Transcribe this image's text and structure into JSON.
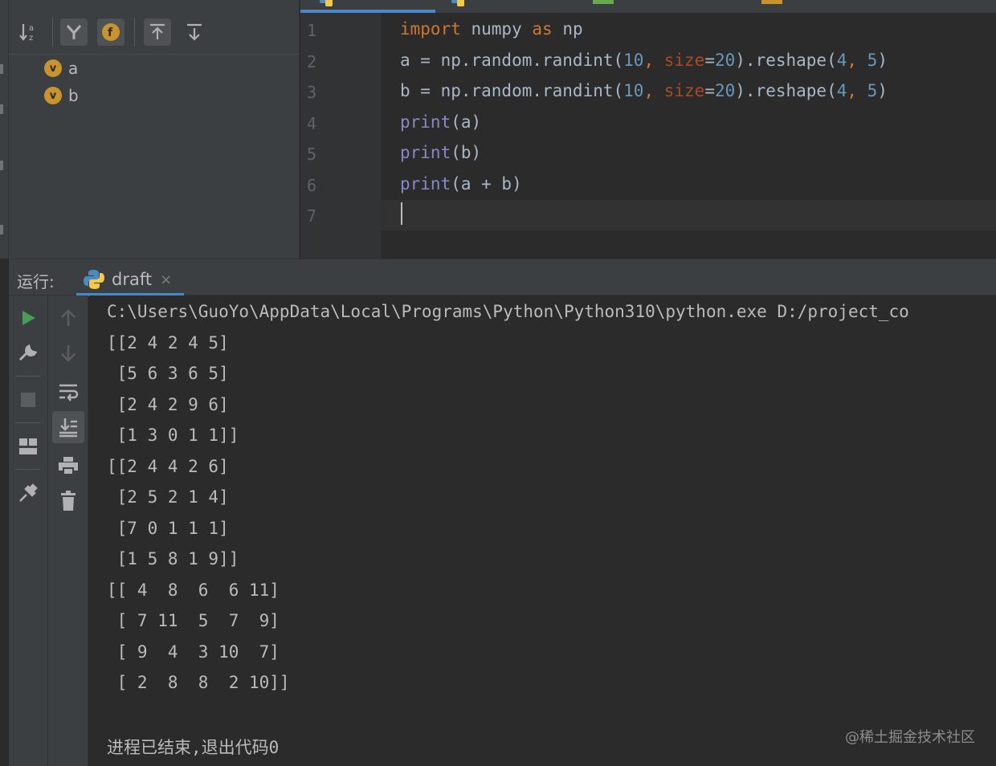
{
  "structure": {
    "items": [
      {
        "badge": "v",
        "label": "a"
      },
      {
        "badge": "v",
        "label": "b"
      }
    ]
  },
  "editor": {
    "line_numbers": [
      "1",
      "2",
      "3",
      "4",
      "5",
      "6",
      "7"
    ],
    "lines": [
      [
        {
          "t": "import",
          "c": "kw"
        },
        {
          "t": " numpy ",
          "c": ""
        },
        {
          "t": "as",
          "c": "kw"
        },
        {
          "t": " np",
          "c": ""
        }
      ],
      [
        {
          "t": "a = np.random.randint(",
          "c": ""
        },
        {
          "t": "10",
          "c": "num"
        },
        {
          "t": ", ",
          "c": "kw"
        },
        {
          "t": "size",
          "c": "param"
        },
        {
          "t": "=",
          "c": ""
        },
        {
          "t": "20",
          "c": "num"
        },
        {
          "t": ").reshape(",
          "c": ""
        },
        {
          "t": "4",
          "c": "num"
        },
        {
          "t": ", ",
          "c": "kw"
        },
        {
          "t": "5",
          "c": "num"
        },
        {
          "t": ")",
          "c": ""
        }
      ],
      [
        {
          "t": "b = np.random.randint(",
          "c": ""
        },
        {
          "t": "10",
          "c": "num"
        },
        {
          "t": ", ",
          "c": "kw"
        },
        {
          "t": "size",
          "c": "param"
        },
        {
          "t": "=",
          "c": ""
        },
        {
          "t": "20",
          "c": "num"
        },
        {
          "t": ").reshape(",
          "c": ""
        },
        {
          "t": "4",
          "c": "num"
        },
        {
          "t": ", ",
          "c": "kw"
        },
        {
          "t": "5",
          "c": "num"
        },
        {
          "t": ")",
          "c": ""
        }
      ],
      [
        {
          "t": "print",
          "c": "bi"
        },
        {
          "t": "(a)",
          "c": ""
        }
      ],
      [
        {
          "t": "print",
          "c": "bi"
        },
        {
          "t": "(b)",
          "c": ""
        }
      ],
      [
        {
          "t": "print",
          "c": "bi"
        },
        {
          "t": "(a + b)",
          "c": ""
        }
      ],
      []
    ]
  },
  "run": {
    "label": "运行:",
    "tab_name": "draft",
    "close_glyph": "×",
    "output": [
      "C:\\Users\\GuoYo\\AppData\\Local\\Programs\\Python\\Python310\\python.exe D:/project_co",
      "[[2 4 2 4 5]",
      " [5 6 3 6 5]",
      " [2 4 2 9 6]",
      " [1 3 0 1 1]]",
      "[[2 4 4 2 6]",
      " [2 5 2 1 4]",
      " [7 0 1 1 1]",
      " [1 5 8 1 9]]",
      "[[ 4  8  6  6 11]",
      " [ 7 11  5  7  9]",
      " [ 9  4  3 10  7]",
      " [ 2  8  8  2 10]]",
      "",
      "进程已结束,退出代码0"
    ],
    "watermark": "@稀土掘金技术社区"
  },
  "colors": {
    "accent": "#4a88c7",
    "run_green": "#499c54",
    "keyword": "#cc7832",
    "number": "#6897bb",
    "builtin": "#8888c6",
    "param": "#aa4926"
  }
}
